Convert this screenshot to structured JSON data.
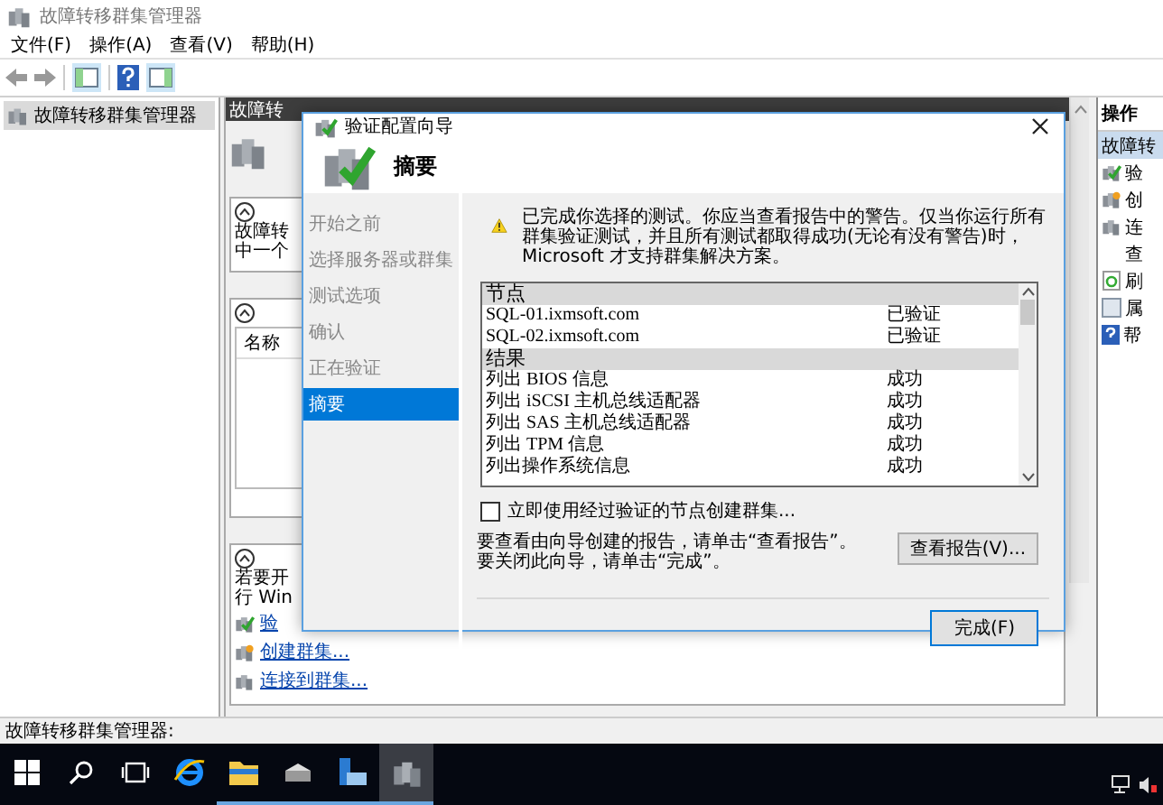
{
  "window": {
    "title": "故障转移群集管理器"
  },
  "menu": [
    "文件(F)",
    "操作(A)",
    "查看(V)",
    "帮助(H)"
  ],
  "tree": {
    "items": [
      {
        "label": "故障转移群集管理器",
        "selected": true
      }
    ]
  },
  "center": {
    "header": "故障转",
    "overview": {
      "lines": [
        "故障转",
        "中一个"
      ]
    },
    "clusters": {
      "column": "名称"
    },
    "manage": {
      "lines": [
        "若要开",
        "行 Win"
      ],
      "links": [
        "验",
        "创建群集...",
        "连接到群集..."
      ]
    }
  },
  "actions": {
    "title": "操作",
    "items": [
      {
        "label": "故障转",
        "selected": true,
        "kind": "cluster"
      },
      {
        "label": "验",
        "selected": false,
        "kind": "check"
      },
      {
        "label": "创",
        "selected": false,
        "kind": "create"
      },
      {
        "label": "连",
        "selected": false,
        "kind": "connect"
      },
      {
        "label": "查",
        "selected": false,
        "kind": "none"
      },
      {
        "label": "刷",
        "selected": false,
        "kind": "refresh"
      },
      {
        "label": "属",
        "selected": false,
        "kind": "properties"
      },
      {
        "label": "帮",
        "selected": false,
        "kind": "help"
      }
    ]
  },
  "status_bar": "故障转移群集管理器:",
  "taskbar": [
    {
      "kind": "start",
      "running": false,
      "active": false
    },
    {
      "kind": "search",
      "running": false,
      "active": false
    },
    {
      "kind": "taskview",
      "running": false,
      "active": false
    },
    {
      "kind": "browser",
      "running": false,
      "active": false
    },
    {
      "kind": "folder",
      "running": true,
      "active": false
    },
    {
      "kind": "drive",
      "running": true,
      "active": false
    },
    {
      "kind": "server",
      "running": true,
      "active": false
    },
    {
      "kind": "cluster",
      "running": true,
      "active": true
    }
  ],
  "dialog": {
    "title": "验证配置向导",
    "heading": "摘要",
    "steps": [
      {
        "label": "开始之前",
        "selected": false
      },
      {
        "label": "选择服务器或群集",
        "selected": false
      },
      {
        "label": "测试选项",
        "selected": false
      },
      {
        "label": "确认",
        "selected": false
      },
      {
        "label": "正在验证",
        "selected": false
      },
      {
        "label": "摘要",
        "selected": true
      }
    ],
    "warning": "已完成你选择的测试。你应当查看报告中的警告。仅当你运行所有群集验证测试，并且所有测试都取得成功(无论有没有警告)时，Microsoft 才支持群集解决方案。",
    "report": [
      {
        "title": "节点",
        "rows": [
          {
            "name": "SQL-01.ixmsoft.com",
            "result": "已验证"
          },
          {
            "name": "SQL-02.ixmsoft.com",
            "result": "已验证"
          }
        ]
      },
      {
        "title": "结果",
        "rows": [
          {
            "name": "列出 BIOS 信息",
            "result": "成功"
          },
          {
            "name": "列出 iSCSI 主机总线适配器",
            "result": "成功"
          },
          {
            "name": "列出 SAS 主机总线适配器",
            "result": "成功"
          },
          {
            "name": "列出 TPM 信息",
            "result": "成功"
          },
          {
            "name": "列出操作系统信息",
            "result": "成功"
          }
        ]
      }
    ],
    "create_now": {
      "label": "立即使用经过验证的节点创建群集...",
      "checked": false
    },
    "info": [
      "要查看由向导创建的报告，请单击“查看报告”。",
      "要关闭此向导，请单击“完成”。"
    ],
    "view_report": "查看报告(V)...",
    "finish": "完成(F)"
  }
}
